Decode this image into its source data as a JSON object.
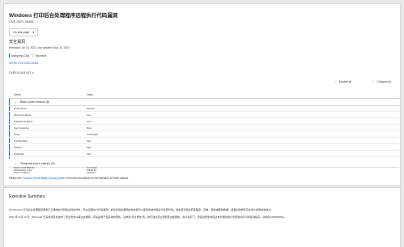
{
  "header": {
    "title": "Windows 打印后台处理程序远程执行代码漏洞",
    "cve_id": "CVE-2021-34481",
    "on_this_page": "On this page"
  },
  "security": {
    "heading": "安全漏洞",
    "dates": "Released: Jul 15, 2021 Last updated: Aug 10, 2021",
    "assigning_cna_label": "Assigning CNA",
    "assigning_cna_value": "Microsoft",
    "mitre_link": "MITRE CVE-2021-34481",
    "cvss": "CVSS:3.0 8.8 / 8.2"
  },
  "controls": {
    "expand_all": "Expand all",
    "collapse_all": "Collapse all"
  },
  "table": {
    "col_metric": "Metric",
    "col_value": "Value",
    "base_group": "Base score metrics (8)",
    "base_rows": [
      {
        "metric": "Attack Vector",
        "value": "Network"
      },
      {
        "metric": "Attack Complexity",
        "value": "Low"
      },
      {
        "metric": "Privileges Required",
        "value": "Low"
      },
      {
        "metric": "User Interaction",
        "value": "None"
      },
      {
        "metric": "Scope",
        "value": "Unchanged"
      },
      {
        "metric": "Confidentiality",
        "value": "High"
      },
      {
        "metric": "Integrity",
        "value": "High"
      },
      {
        "metric": "Availability",
        "value": "High"
      }
    ],
    "temporal_group": "Temporal score metrics (3)",
    "temporal_rows": [
      {
        "metric": "Exploit Code Maturity",
        "value": "Functional"
      },
      {
        "metric": "Remediation Level",
        "value": "Official Fix"
      },
      {
        "metric": "Report Confidence",
        "value": "Confirmed"
      }
    ]
  },
  "footnote": {
    "prefix": "Please see",
    "link": "Common Vulnerability Scoring System",
    "suffix": "for more information on the definition of these metrics."
  },
  "executive_summary": {
    "title": "Executive Summary",
    "line1": "当 Windows 打印后台处理程序服务不正确地执行特权文件操作时，存在远程执行代码漏洞。成功利用此漏洞的攻击者可以使用系统特权运行任意代码。攻击者可随后安装程序；查看、更改或删除数据；或者创建拥有完全用户权限的新帐户。",
    "line2": "2021 年 8 月 10 日：Microsoft 已完成调查并发布了安全更新以解决此漏洞。有关适用于您系统的更新，请参阅“安全更新”表。我们建议您立即安装这些更新。默认情况下，安装此更新将阻止非管理员用户安装新的打印机驱动程序，请参阅 KB5005652。"
  },
  "colors": {
    "accent": "#0f6cbd",
    "page_bg": "#e9e9e9",
    "card_bg": "#ffffff"
  },
  "icons": [
    "chevron-down-icon",
    "shield-icon",
    "chevron-right-icon"
  ]
}
